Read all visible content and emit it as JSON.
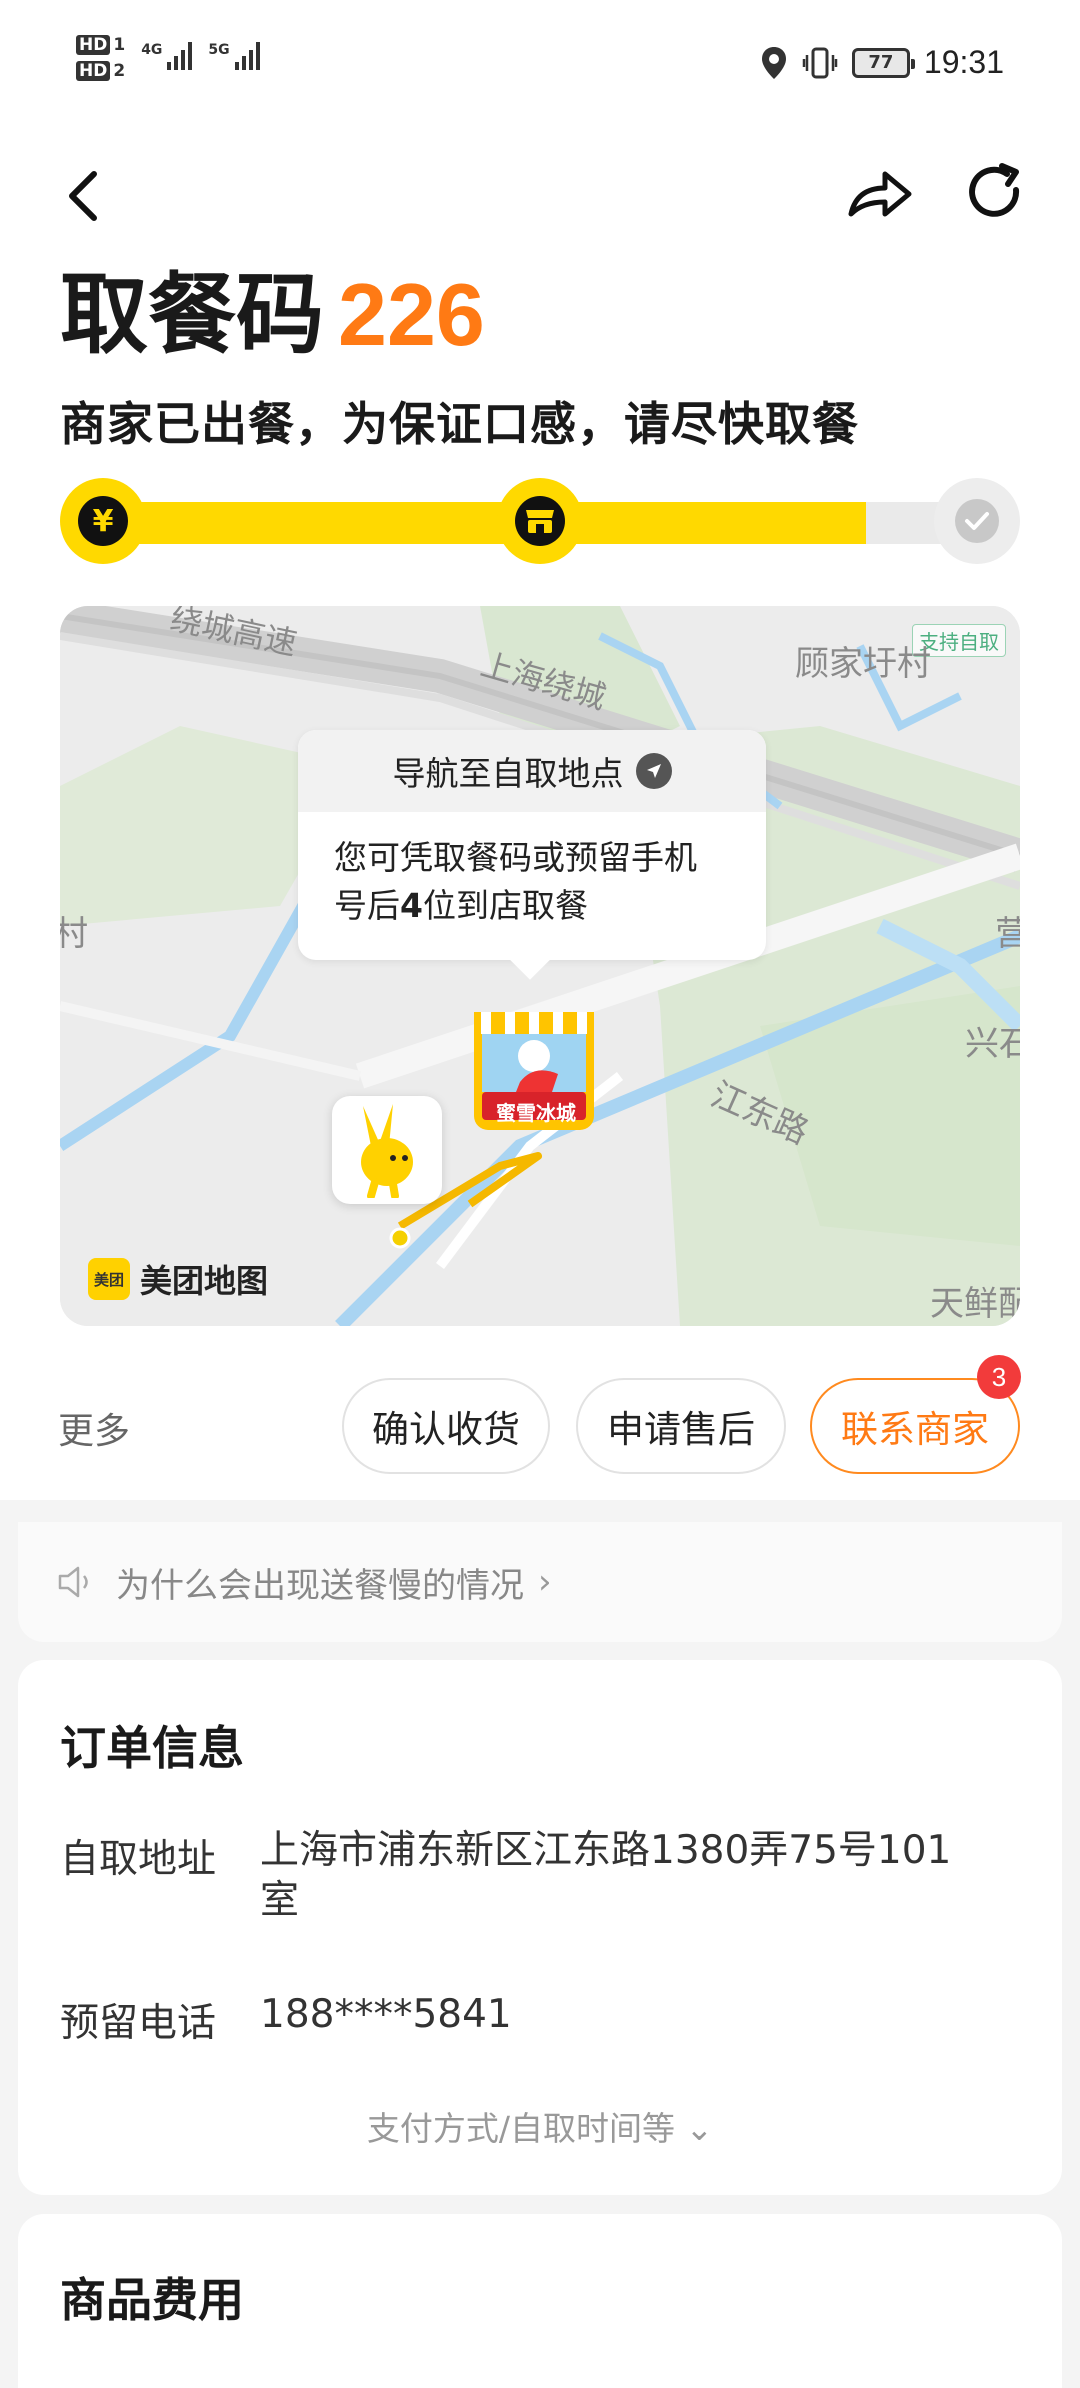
{
  "status_bar": {
    "hd1": "HD",
    "hd1_sub": "1",
    "hd2": "HD",
    "hd2_sub": "2",
    "net1": "4G",
    "net2": "5G",
    "battery": "77",
    "time": "19:31"
  },
  "header": {
    "title_prefix": "取餐码",
    "pickup_code": "226",
    "subtitle": "商家已出餐，为保证口感，请尽快取餐"
  },
  "progress": {
    "steps": [
      "paid",
      "ready",
      "done"
    ],
    "current_step": 2,
    "fill_fraction": 0.87,
    "yuan_symbol": "¥"
  },
  "map": {
    "tag": "支持自取",
    "labels": {
      "highway": "绕城高速",
      "highway2": "上海绕城",
      "village": "顾家圩村",
      "road": "江东路",
      "left_edge": "村",
      "right_edge": "兴石",
      "right_edge2": "营",
      "bottom_right": "天鲜配"
    },
    "tooltip_nav": "导航至自取地点",
    "tooltip_body_1": "您可凭取餐码或预留手机",
    "tooltip_body_2a": "号后",
    "tooltip_body_2b": "4",
    "tooltip_body_2c": "位到店取餐",
    "store_name": "蜜雪冰城",
    "brand_logo": "美团",
    "brand_text": "美团地图"
  },
  "actions": {
    "more": "更多",
    "confirm": "确认收货",
    "after_sale": "申请售后",
    "contact": "联系商家",
    "contact_badge": "3"
  },
  "notice": {
    "text": "为什么会出现送餐慢的情况",
    "chevron": "›"
  },
  "order_info": {
    "title": "订单信息",
    "address_label": "自取地址",
    "address_line1": "上海市浦东新区江东路1380弄75号101",
    "address_line2": "室",
    "phone_label": "预留电话",
    "phone_value": "188****5841",
    "expand_text": "支付方式/自取时间等",
    "expand_chevron": "⌄"
  },
  "fees": {
    "title": "商品费用"
  },
  "colors": {
    "accent_orange": "#ff7a14",
    "brand_yellow": "#ffd900",
    "badge_red": "#f23b3b"
  }
}
